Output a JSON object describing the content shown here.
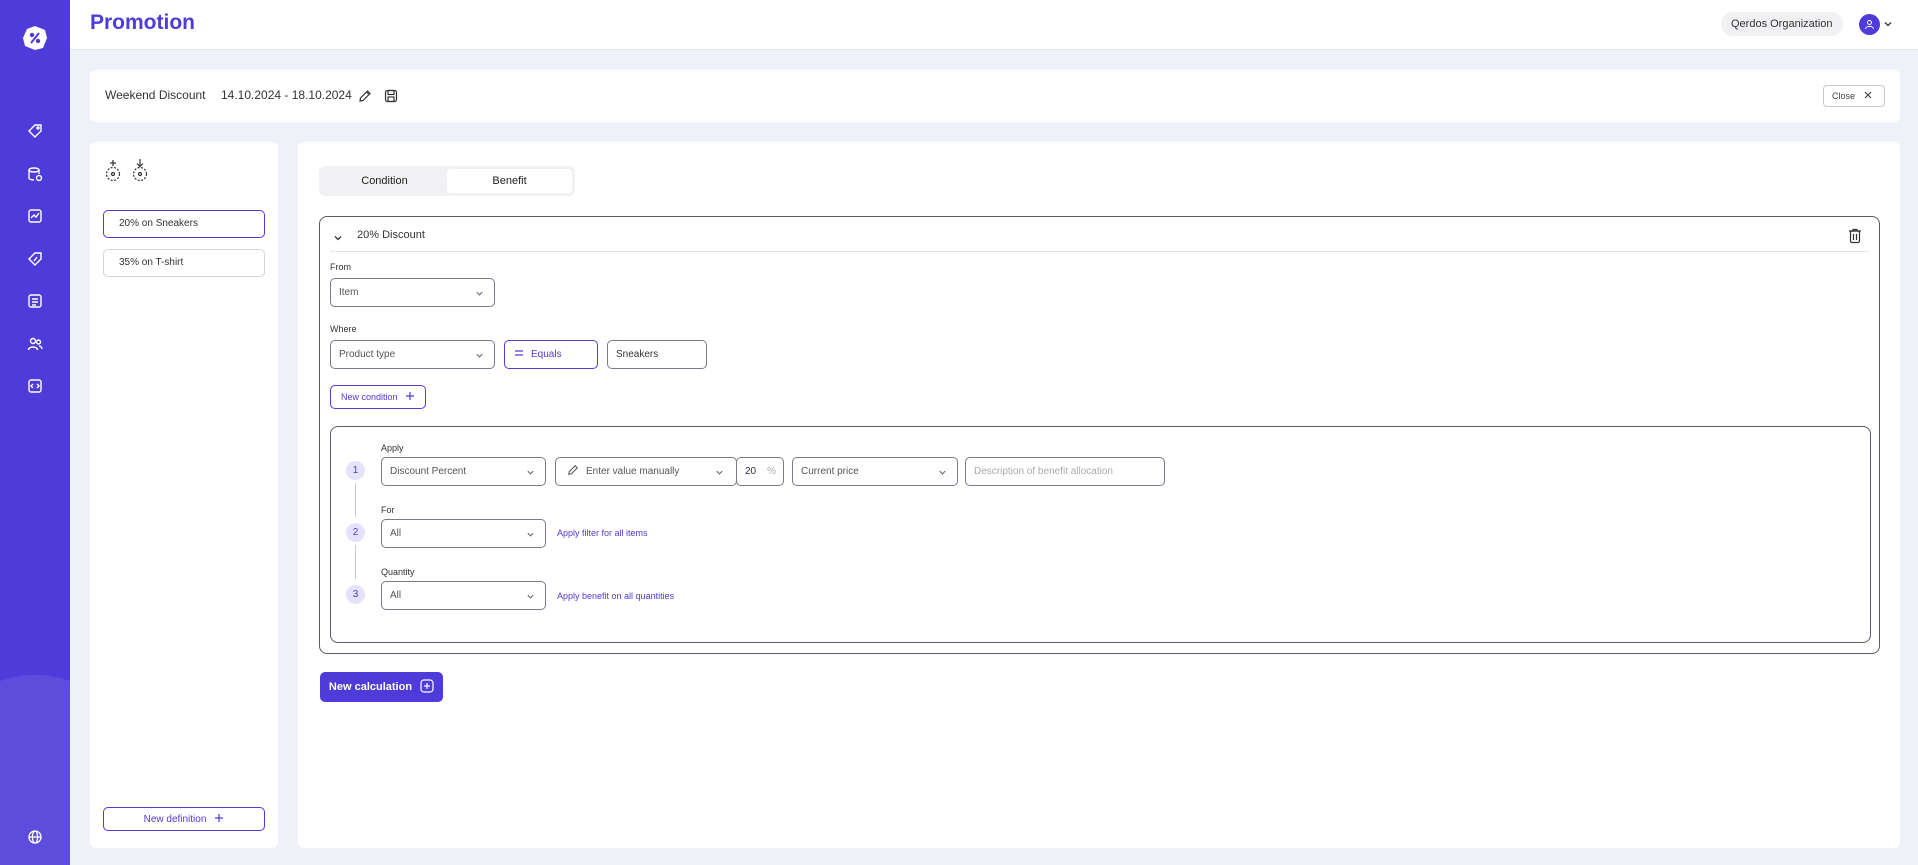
{
  "app": {
    "title": "Promotion"
  },
  "header": {
    "organization": "Qerdos Organization"
  },
  "promotion": {
    "name": "Weekend Discount",
    "dates": "14.10.2024 - 18.10.2024",
    "close_label": "Close"
  },
  "definitions": {
    "items": [
      {
        "label": "20% on Sneakers",
        "active": true
      },
      {
        "label": "35% on T-shirt",
        "active": false
      }
    ],
    "new_label": "New definition"
  },
  "tabs": [
    {
      "label": "Condition",
      "active": false
    },
    {
      "label": "Benefit",
      "active": true
    }
  ],
  "calculation": {
    "title": "20% Discount",
    "from_label": "From",
    "from_value": "Item",
    "where_label": "Where",
    "where_field": "Product type",
    "where_operator": "Equals",
    "where_value": "Sneakers",
    "new_condition_label": "New condition"
  },
  "benefit": {
    "apply_label": "Apply",
    "apply_type": "Discount Percent",
    "value_mode": "Enter value manually",
    "value": "20",
    "value_unit": "%",
    "price_basis": "Current price",
    "description_placeholder": "Description of benefit allocation",
    "for_label": "For",
    "for_value": "All",
    "for_hint": "Apply filter for all items",
    "quantity_label": "Quantity",
    "quantity_value": "All",
    "quantity_hint": "Apply benefit on all quantities",
    "steps": [
      "1",
      "2",
      "3"
    ]
  },
  "new_calculation_label": "New calculation",
  "colors": {
    "accent": "#4f3bd9",
    "rail": "#4f3bd9",
    "background": "#eef1f7"
  }
}
